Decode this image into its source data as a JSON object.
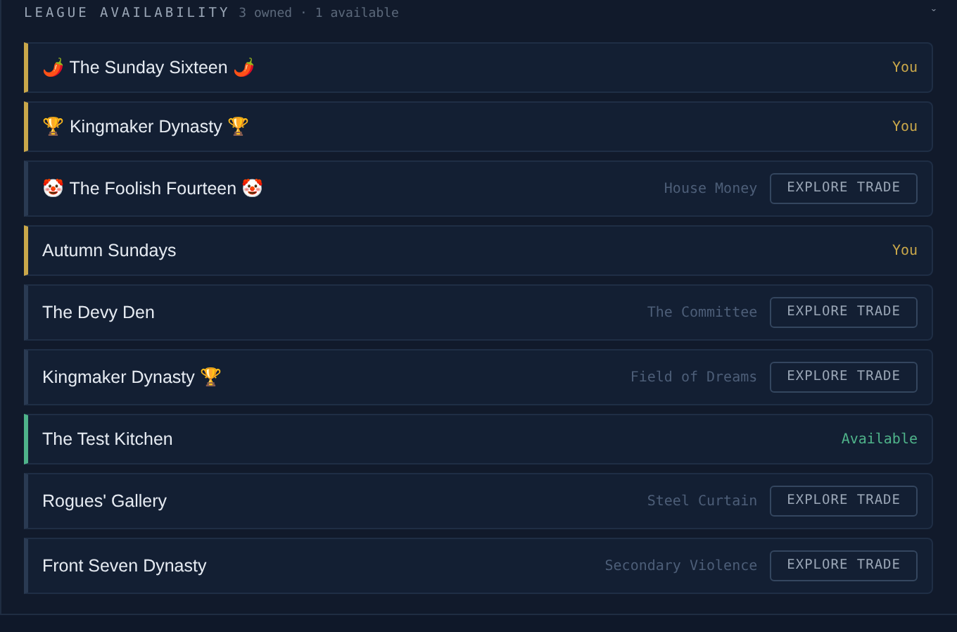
{
  "header": {
    "title": "LEAGUE AVAILABILITY",
    "summary": "3 owned · 1 available",
    "toggle": "ˇ"
  },
  "leagues": [
    {
      "name": "🌶️ The Sunday Sixteen 🌶️",
      "kind": "you",
      "status": "You"
    },
    {
      "name": "🏆 Kingmaker Dynasty 🏆",
      "kind": "you",
      "status": "You"
    },
    {
      "name": "🤡 The Foolish Fourteen 🤡",
      "kind": "trade",
      "owner": "House Money",
      "button": "EXPLORE TRADE"
    },
    {
      "name": "Autumn Sundays",
      "kind": "you",
      "status": "You"
    },
    {
      "name": "The Devy Den",
      "kind": "trade",
      "owner": "The Committee",
      "button": "EXPLORE TRADE"
    },
    {
      "name": "Kingmaker Dynasty 🏆",
      "kind": "trade",
      "owner": "Field of Dreams",
      "button": "EXPLORE TRADE"
    },
    {
      "name": "The Test Kitchen",
      "kind": "available",
      "status": "Available"
    },
    {
      "name": "Rogues' Gallery",
      "kind": "trade",
      "owner": "Steel Curtain",
      "button": "EXPLORE TRADE"
    },
    {
      "name": "Front Seven Dynasty",
      "kind": "trade",
      "owner": "Secondary Violence",
      "button": "EXPLORE TRADE"
    }
  ]
}
